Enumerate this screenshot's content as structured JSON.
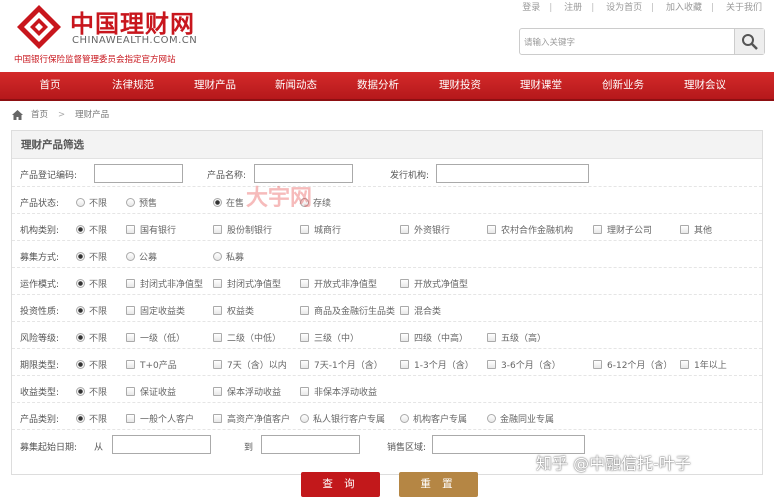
{
  "brand": {
    "cn_name": "中国理财网",
    "en_name": "CHINAWEALTH.COM.CN",
    "subtitle": "中国银行保险监督管理委员会指定官方网站",
    "logo_color": "#c8161d"
  },
  "toplinks": [
    "登录",
    "注册",
    "设为首页",
    "加入收藏",
    "关于我们"
  ],
  "search": {
    "placeholder": "请输入关键字",
    "icon": "search-icon"
  },
  "nav": {
    "bg_color": "#c41e22",
    "items": [
      "首页",
      "法律规范",
      "理财产品",
      "新闻动态",
      "数据分析",
      "理财投资",
      "理财课堂",
      "创新业务",
      "理财会议"
    ]
  },
  "breadcrumb": {
    "home": "首页",
    "current": "理财产品"
  },
  "filter": {
    "title": "理财产品筛选",
    "reg_code_label": "产品登记编码:",
    "name_label": "产品名称:",
    "issuer_label": "发行机构:",
    "status": {
      "label": "产品状态:",
      "options": [
        "不限",
        "预售",
        "在售",
        "存续"
      ],
      "selected": "在售"
    },
    "org_type": {
      "label": "机构类别:",
      "options": [
        "不限",
        "国有银行",
        "股份制银行",
        "城商行",
        "外资银行",
        "农村合作金融机构",
        "理财子公司",
        "其他"
      ],
      "selected": "不限"
    },
    "raise": {
      "label": "募集方式:",
      "options": [
        "不限",
        "公募",
        "私募"
      ],
      "selected": "不限"
    },
    "operation": {
      "label": "运作模式:",
      "options": [
        "不限",
        "封闭式非净值型",
        "封闭式净值型",
        "开放式非净值型",
        "开放式净值型"
      ],
      "selected": "不限"
    },
    "invest": {
      "label": "投资性质:",
      "options": [
        "不限",
        "固定收益类",
        "权益类",
        "商品及金融衍生品类",
        "混合类"
      ],
      "selected": "不限"
    },
    "risk": {
      "label": "风险等级:",
      "options": [
        "不限",
        "一级（低）",
        "二级（中低）",
        "三级（中）",
        "四级（中高）",
        "五级（高）"
      ],
      "selected": "不限"
    },
    "term": {
      "label": "期限类型:",
      "options": [
        "不限",
        "T+0产品",
        "7天（含）以内",
        "7天-1个月（含）",
        "1-3个月（含）",
        "3-6个月（含）",
        "6-12个月（含）",
        "1年以上"
      ],
      "selected": "不限"
    },
    "yield": {
      "label": "收益类型:",
      "options": [
        "不限",
        "保证收益",
        "保本浮动收益",
        "非保本浮动收益"
      ],
      "selected": "不限"
    },
    "ptype": {
      "label": "产品类别:",
      "options": [
        "不限",
        "一般个人客户",
        "高资产净值客户",
        "私人银行客户专属",
        "机构客户专属",
        "金融同业专属"
      ],
      "selected": "不限"
    },
    "date_label": "募集起始日期:",
    "from": "从",
    "to": "到",
    "region_label": "销售区域:",
    "query": "查 询",
    "reset": "重 置"
  },
  "watermark": "大宇网",
  "credit": "知乎 @中融信托-叶子"
}
